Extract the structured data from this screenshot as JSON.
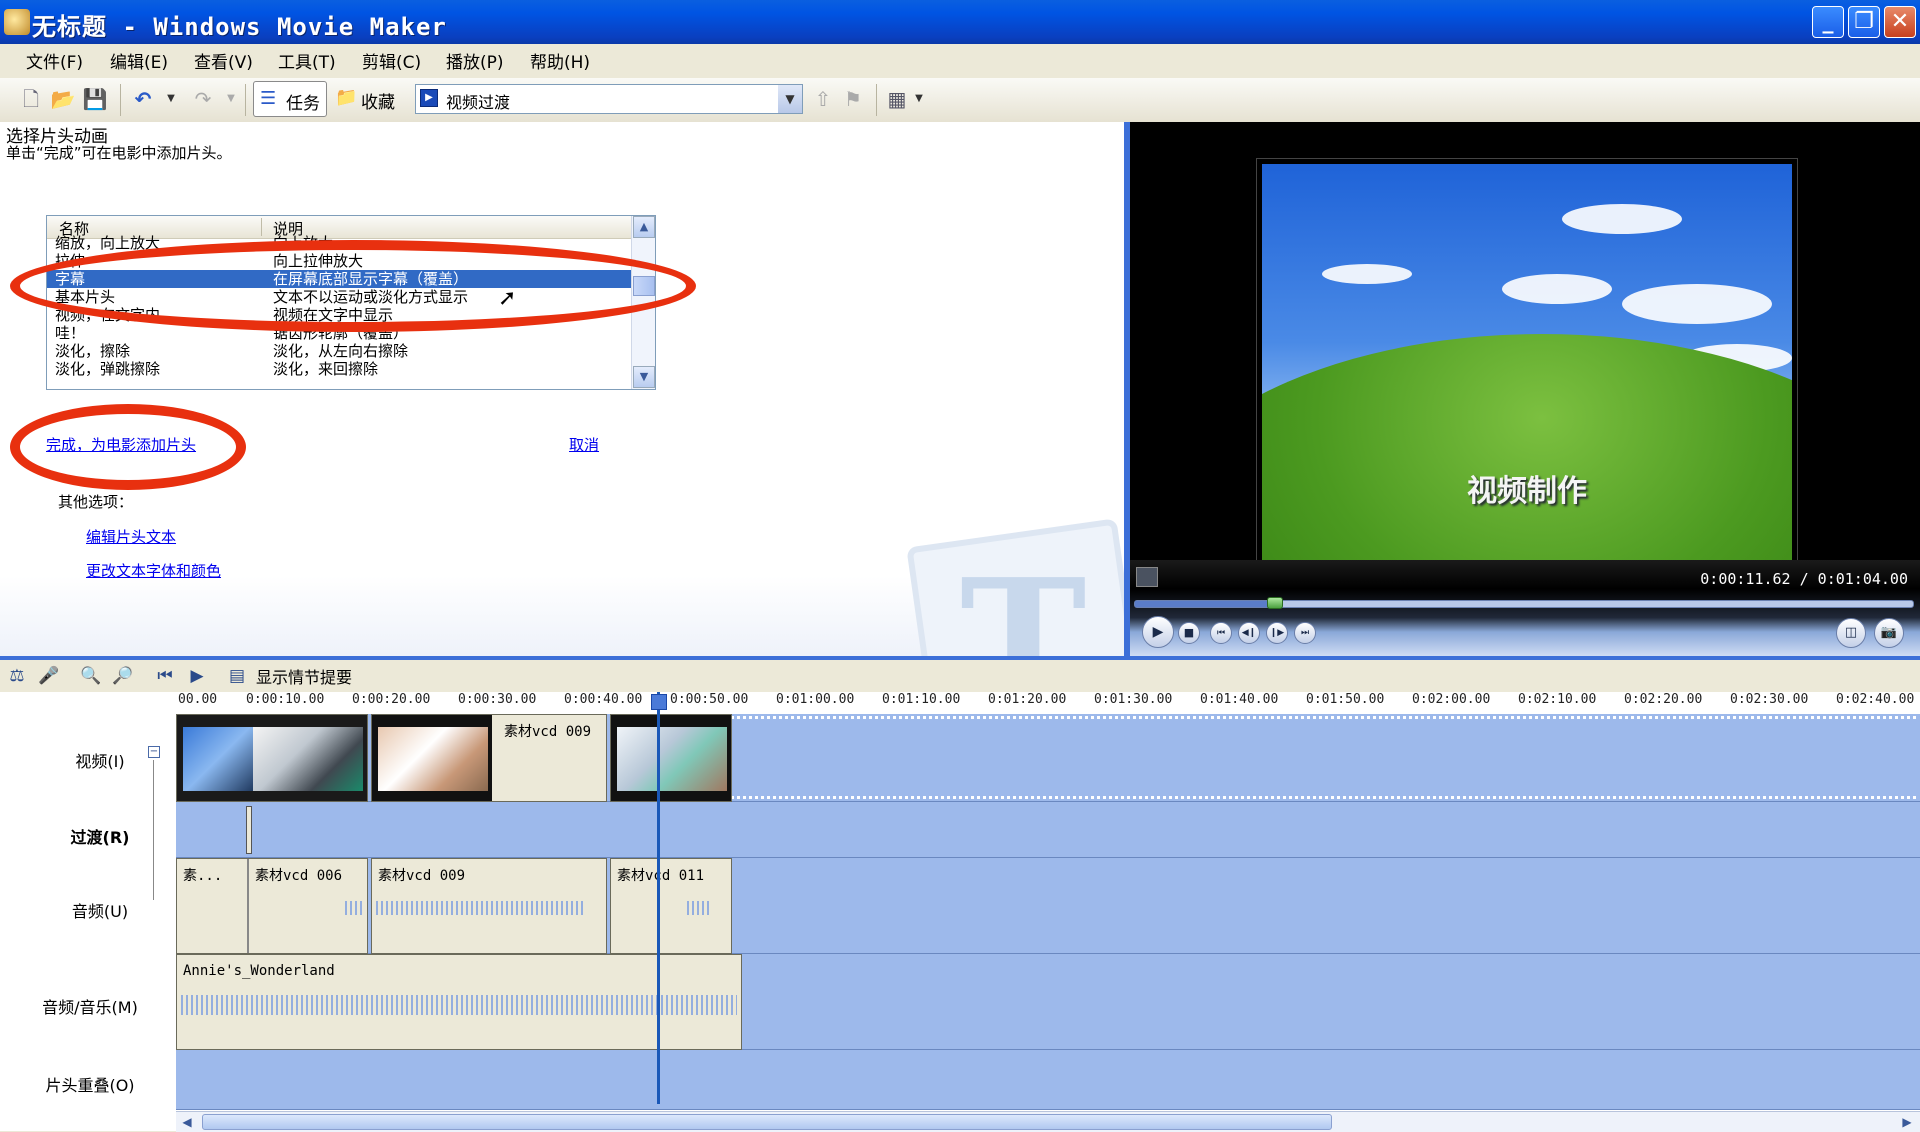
{
  "window": {
    "title": "无标题 - Windows Movie Maker",
    "min": "_",
    "max": "❐",
    "close": "✕"
  },
  "menu": [
    "文件(F)",
    "编辑(E)",
    "查看(V)",
    "工具(T)",
    "剪辑(C)",
    "播放(P)",
    "帮助(H)"
  ],
  "toolbar": {
    "tasks_label": "任务",
    "favorites_label": "收藏",
    "combo_value": "视频过渡"
  },
  "task_pane": {
    "heading": "选择片头动画",
    "description": "单击“完成”可在电影中添加片头。",
    "list": {
      "col_name": "名称",
      "col_desc": "说明",
      "rows": [
        {
          "name": "缩放，向上放大",
          "desc": "向上放大"
        },
        {
          "name": "拉伸",
          "desc": "向上拉伸放大"
        },
        {
          "name": "字幕",
          "desc": "在屏幕底部显示字幕（覆盖）",
          "selected": true
        },
        {
          "name": "基本片头",
          "desc": "文本不以运动或淡化方式显示"
        },
        {
          "name": "视频，在文字内",
          "desc": "视频在文字中显示"
        },
        {
          "name": "哇！",
          "desc": "锯齿形轮廓（覆盖）"
        },
        {
          "name": "淡化，擦除",
          "desc": "淡化，从左向右擦除"
        },
        {
          "name": "淡化，弹跳擦除",
          "desc": "淡化，来回擦除"
        }
      ]
    },
    "done_link": "完成，为电影添加片头",
    "cancel_link": "取消",
    "other_options": "其他选项：",
    "edit_text_link": "编辑片头文本",
    "change_font_link": "更改文本字体和颜色"
  },
  "preview": {
    "caption": "视频制作",
    "time": "0:00:11.62 / 0:01:04.00",
    "progress": 0.18
  },
  "timeline": {
    "storyboard_label": "显示情节提要",
    "ruler_ticks": [
      "00.00",
      "0:00:10.00",
      "0:00:20.00",
      "0:00:30.00",
      "0:00:40.00",
      "0:00:50.00",
      "0:01:00.00",
      "0:01:10.00",
      "0:01:20.00",
      "0:01:30.00",
      "0:01:40.00",
      "0:01:50.00",
      "0:02:00.00",
      "0:02:10.00",
      "0:02:20.00",
      "0:02:30.00",
      "0:02:40.00"
    ],
    "tracks": {
      "video": "视频(I)",
      "transition": "过渡(R)",
      "audio": "音频(U)",
      "music": "音频/音乐(M)",
      "title_overlay": "片头重叠(O)"
    },
    "video_clips": [
      "素材vcd 009"
    ],
    "audio_clips": [
      "素...",
      "素材vcd 006",
      "素材vcd 009",
      "素材vcd 011"
    ],
    "music_clips": [
      "Annie's_Wonderland"
    ]
  },
  "colors": {
    "accent": "#316AC5",
    "annotation_ring": "#E8300F",
    "track_bg": "#9DB9EB"
  }
}
